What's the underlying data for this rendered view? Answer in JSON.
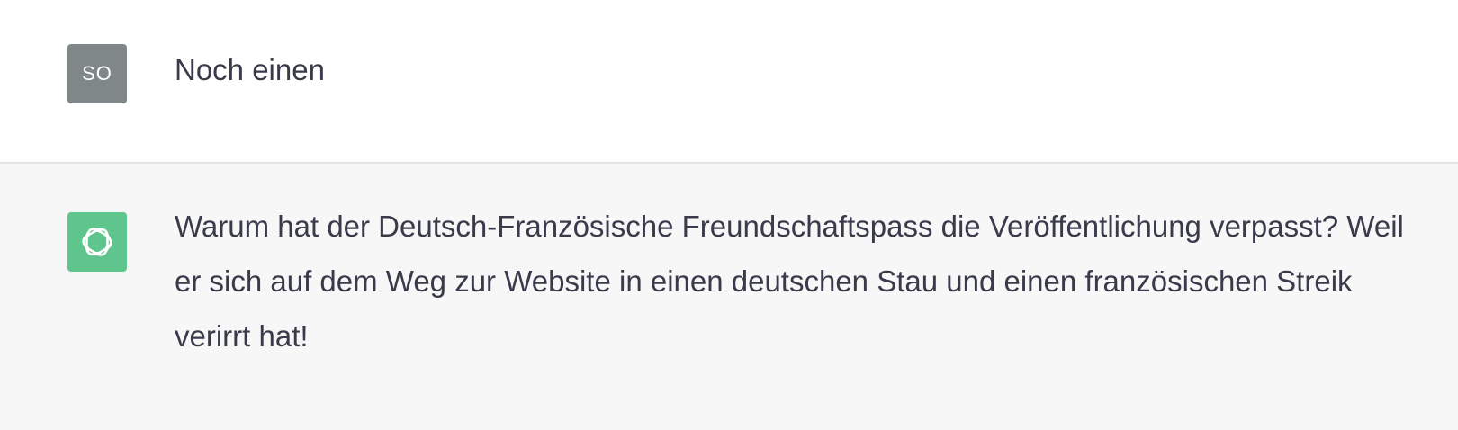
{
  "conversation": {
    "user_message": {
      "avatar_initials": "SO",
      "text": "Noch einen"
    },
    "assistant_message": {
      "avatar_icon": "openai-logo-icon",
      "avatar_color": "#5ec58d",
      "text": "Warum hat der Deutsch-Französische Freundschaftspass die Veröffentlichung verpasst? Weil er sich auf dem Weg zur Website in einen deutschen Stau und einen französischen Streik verirrt hat!"
    }
  },
  "colors": {
    "user_avatar_bg": "#7f8788",
    "assistant_row_bg": "#f7f7f8",
    "text": "#3a3b4a",
    "divider": "#e3e3e6"
  }
}
